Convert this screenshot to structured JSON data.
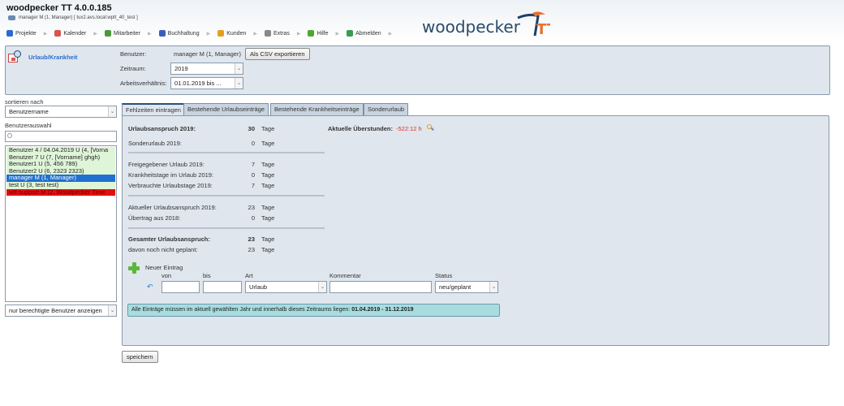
{
  "header": {
    "title": "woodpecker TT 4.0.0.185",
    "session": "manager M (1, Manager) [ tux2.avs.local:wptt_40_test ]",
    "logo_text": "woodpecker",
    "logo_suffix": "TT"
  },
  "nav": [
    {
      "label": "Projekte",
      "icon": "projects-icon",
      "color": "#2a6bd1"
    },
    {
      "label": "Kalender",
      "icon": "calendar-icon",
      "color": "#d9534f"
    },
    {
      "label": "Mitarbeiter",
      "icon": "users-icon",
      "color": "#4a9a3a"
    },
    {
      "label": "Buchhaltung",
      "icon": "accounting-icon",
      "color": "#3a5ec0"
    },
    {
      "label": "Kunden",
      "icon": "customers-icon",
      "color": "#e0a020"
    },
    {
      "label": "Extras",
      "icon": "extras-icon",
      "color": "#888888"
    },
    {
      "label": "Hilfe",
      "icon": "help-icon",
      "color": "#4aaa30"
    },
    {
      "label": "Abmelden",
      "icon": "logout-icon",
      "color": "#3a9a50"
    }
  ],
  "top": {
    "module": "Urlaub/Krankheit",
    "benutzer_label": "Benutzer:",
    "benutzer_value": "manager M (1, Manager)",
    "export_button": "Als CSV exportieren",
    "zeitraum_label": "Zeitraum:",
    "zeitraum_value": "2019",
    "arbeit_label": "Arbeitsverhältnis:",
    "arbeit_value": "01.01.2019 bis ..."
  },
  "left": {
    "sort_label": "sortieren nach",
    "sort_value": "Benutzername",
    "select_label": "Benutzerauswahl",
    "search_placeholder": "",
    "users": [
      {
        "name": "Benutzer 4 / 04.04.2019 U (4, [Vorna",
        "state": "ok"
      },
      {
        "name": "Benutzer 7 U (7, [Vorname] ghgh)",
        "state": "ok"
      },
      {
        "name": "Benutzer1 U (5, 456 789)",
        "state": "ok"
      },
      {
        "name": "Benutzer2 U (6, 2323 2323)",
        "state": "ok"
      },
      {
        "name": "manager M (1, Manager)",
        "state": "selected"
      },
      {
        "name": "test U (3, test test)",
        "state": "ok"
      },
      {
        "name": "wtt-support M (2, Woodpecker Time",
        "state": "error"
      }
    ],
    "filter_value": "nur berechtigte Benutzer anzeigen"
  },
  "tabs": [
    "Fehlzeiten eintragen",
    "Bestehende Urlaubseinträge",
    "Bestehende Krankheitseinträge",
    "Sonderurlaub"
  ],
  "summary": {
    "unit": "Tage",
    "rows": [
      {
        "label": "Urlaubsanspruch 2019:",
        "value": "30",
        "bold": true
      },
      {
        "label": "Sonderurlaub 2019:",
        "value": "0"
      },
      {
        "label": "Freigegebener Urlaub 2019:",
        "value": "7"
      },
      {
        "label": "Krankheitstage im Urlaub 2019:",
        "value": "0"
      },
      {
        "label": "Verbrauchte Urlaubstage 2019:",
        "value": "7"
      },
      {
        "label": "Aktueller Urlaubsanspruch 2019:",
        "value": "23"
      },
      {
        "label": "Übertrag aus 2018:",
        "value": "0"
      },
      {
        "label": "Gesamter Urlaubsanspruch:",
        "value": "23",
        "bold": true
      },
      {
        "label": "davon noch nicht geplant:",
        "value": "23"
      }
    ],
    "overtime_label": "Aktuelle Überstunden:",
    "overtime_value": "-522:12 h",
    "overtime_color": "#e03020"
  },
  "entry": {
    "new_label": "Neuer Eintrag",
    "von": "von",
    "bis": "bis",
    "art": "Art",
    "kommentar": "Kommentar",
    "status": "Status",
    "art_value": "Urlaub",
    "status_value": "neu/geplant",
    "info_text": "Alle Einträge müssen im aktuell gewählten Jahr und innerhalb dieses Zeitraums liegen: ",
    "info_range": "01.04.2019 - 31.12.2019"
  },
  "save_button": "speichern"
}
